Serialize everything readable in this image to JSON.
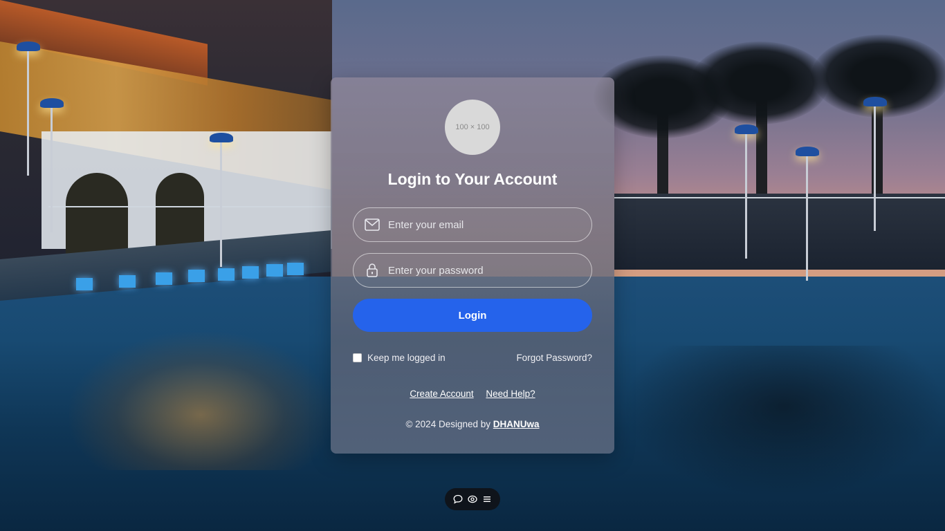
{
  "avatar": {
    "placeholder_text": "100 × 100"
  },
  "login_form": {
    "title": "Login to Your Account",
    "email_placeholder": "Enter your email",
    "password_placeholder": "Enter your password",
    "login_label": "Login",
    "remember_label": "Keep me logged in",
    "remember_checked": false,
    "forgot_label": "Forgot Password?",
    "create_account_label": "Create Account",
    "need_help_label": "Need Help?"
  },
  "footer": {
    "prefix": "© 2024 Designed by",
    "author": "DHANUwa"
  },
  "toolbar": {
    "icons": [
      "chat-bubble-icon",
      "eye-icon",
      "menu-icon"
    ]
  },
  "colors": {
    "primary_button": "#2563eb",
    "toolbar_bg": "#0f141b"
  }
}
